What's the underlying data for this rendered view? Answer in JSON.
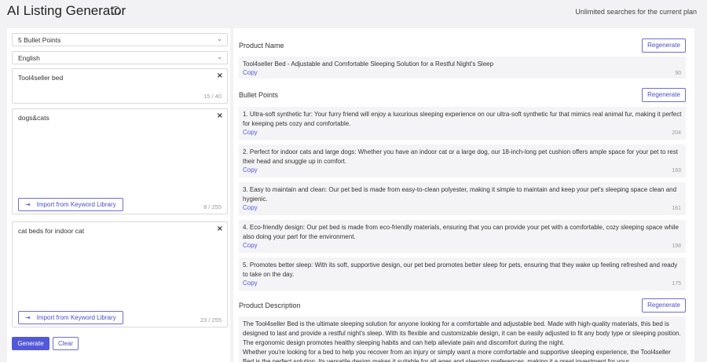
{
  "header": {
    "title": "AI Listing Generator",
    "info_icon": "info-icon",
    "plan_text": "Unlimited searches for the current plan"
  },
  "left": {
    "bullet_count_select": "5 Bullet Points",
    "language_select": "English",
    "product_name_input": {
      "value": "Tool4seller bed",
      "count": "15 / 40"
    },
    "keywords_input": {
      "value": "dogs&cats",
      "count": "8 / 255",
      "import_label": "Import from Keyword Library"
    },
    "description_input": {
      "value": "cat beds for indoor cat",
      "count": "23 / 255",
      "import_label": "Import from Keyword Library"
    },
    "generate_label": "Generate",
    "clear_label": "Clear"
  },
  "right": {
    "regenerate_label": "Regenerate",
    "copy_label": "Copy",
    "product_name": {
      "heading": "Product Name",
      "text": "Tool4seller Bed - Adjustable and Comfortable Sleeping Solution for a Restful Night's Sleep",
      "count": "90"
    },
    "bullet_points": {
      "heading": "Bullet Points",
      "items": [
        {
          "text": "1. Ultra-soft synthetic fur: Your furry friend will enjoy a luxurious sleeping experience on our ultra-soft synthetic fur that mimics real animal fur, making it perfect for keeping pets cozy and comfortable.",
          "count": "204"
        },
        {
          "text": "2. Perfect for indoor cats and large dogs: Whether you have an indoor cat or a large dog, our 18-inch-long pet cushion offers ample space for your pet to rest their head and snuggle up in comfort.",
          "count": "193"
        },
        {
          "text": "3. Easy to maintain and clean: Our pet bed is made from easy-to-clean polyester, making it simple to maintain and keep your pet's sleeping space clean and hygienic.",
          "count": "161"
        },
        {
          "text": "4. Eco-friendly design: Our pet bed is made from eco-friendly materials, ensuring that you can provide your pet with a comfortable, cozy sleeping space while also doing your part for the environment.",
          "count": "198"
        },
        {
          "text": "5. Promotes better sleep: With its soft, supportive design, our pet bed promotes better sleep for pets, ensuring that they wake up feeling refreshed and ready to take on the day.",
          "count": "175"
        }
      ]
    },
    "product_description": {
      "heading": "Product Description",
      "text": "The Tool4seller Bed is the ultimate sleeping solution for anyone looking for a comfortable and adjustable bed. Made with high-quality materials, this bed is designed to last and provide a restful night's sleep. With its flexible and customizable design, it can be easily adjusted to fit any body type or sleeping position. The ergonomic design promotes healthy sleeping habits and can help alleviate pain and discomfort during the night.",
      "text2": "Whether you're looking for a bed to help you recover from an injury or simply want a more comfortable and supportive sleeping experience, the Tool4seller Bed is the perfect solution. Its versatile design makes it suitable for all ages and sleeping preferences, making it a great investment for your"
    }
  }
}
